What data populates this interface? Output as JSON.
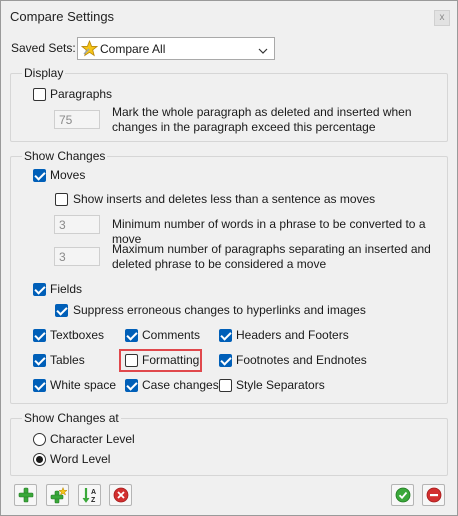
{
  "window": {
    "title": "Compare Settings",
    "close_glyph": "x"
  },
  "saved_sets": {
    "label": "Saved Sets:",
    "selected": "Compare All",
    "icon": "star-icon"
  },
  "display": {
    "legend": "Display",
    "paragraphs": {
      "label": "Paragraphs",
      "checked": false
    },
    "percent_value": "75",
    "percent_desc_line1": "Mark the whole paragraph as deleted and inserted when",
    "percent_desc_line2": "changes in the paragraph exceed this percentage"
  },
  "show_changes": {
    "legend": "Show Changes",
    "moves": {
      "label": "Moves",
      "checked": true
    },
    "inserts_deletes": {
      "label": "Show inserts and deletes less than a sentence as moves",
      "checked": false
    },
    "min_words_value": "3",
    "min_words_desc": "Minimum number of words in a phrase to be converted to a move",
    "max_paragraphs_value": "3",
    "max_paragraphs_desc_line1": "Maximum number of paragraphs separating an inserted and",
    "max_paragraphs_desc_line2": "deleted phrase to be considered a move",
    "fields": {
      "label": "Fields",
      "checked": true
    },
    "suppress": {
      "label": "Suppress erroneous changes to hyperlinks and images",
      "checked": true
    },
    "textboxes": {
      "label": "Textboxes",
      "checked": true
    },
    "comments": {
      "label": "Comments",
      "checked": true
    },
    "headers_footers": {
      "label": "Headers and Footers",
      "checked": true
    },
    "tables": {
      "label": "Tables",
      "checked": true
    },
    "formatting": {
      "label": "Formatting",
      "checked": false
    },
    "footnotes_endnotes": {
      "label": "Footnotes and Endnotes",
      "checked": true
    },
    "white_space": {
      "label": "White space",
      "checked": true
    },
    "case_changes": {
      "label": "Case changes",
      "checked": true
    },
    "style_separators": {
      "label": "Style Separators",
      "checked": false
    }
  },
  "show_changes_at": {
    "legend": "Show Changes at",
    "character_level": {
      "label": "Character Level",
      "selected": false
    },
    "word_level": {
      "label": "Word Level",
      "selected": true
    }
  },
  "toolbar": {
    "add": "plus-icon",
    "add_star": "star-plus-icon",
    "sort": "sort-az-icon",
    "delete": "delete-icon",
    "ok": "ok-icon",
    "cancel": "cancel-icon",
    "sort_letter_a": "A",
    "sort_letter_z": "Z"
  },
  "colors": {
    "accent": "#005fb8",
    "highlight": "#e0484c",
    "green": "#3aa83a",
    "red": "#d22f2f"
  }
}
